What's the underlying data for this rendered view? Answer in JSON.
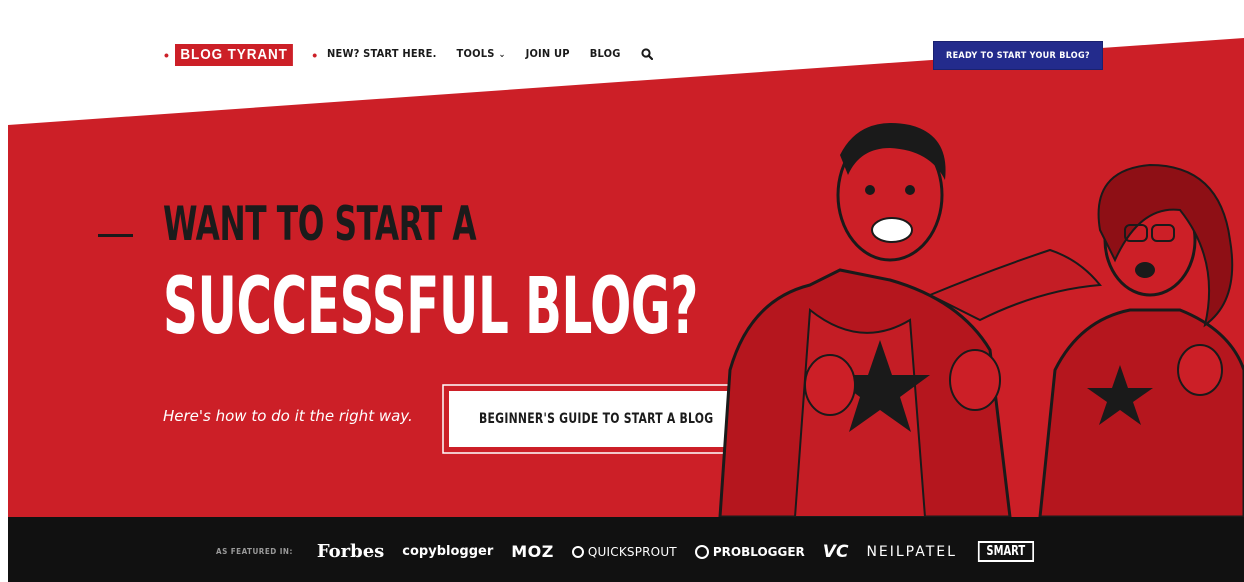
{
  "nav": {
    "logo_text": "BLOG TYRANT",
    "links": [
      {
        "label": "NEW? START HERE."
      },
      {
        "label": "TOOLS",
        "caret": "⌄"
      },
      {
        "label": "JOIN UP"
      },
      {
        "label": "BLOG"
      }
    ],
    "search_icon": "search-icon",
    "cta_label": "READY TO START YOUR BLOG?"
  },
  "hero": {
    "headline_line1": "WANT TO START A",
    "headline_line2": "SUCCESSFUL BLOG?",
    "subtext": "Here's how to do it the right way.",
    "cta_label": "BEGINNER'S GUIDE TO START A BLOG",
    "cta_icon": "double-chevron-right-icon",
    "cta_icon_glyph": "»"
  },
  "featured": {
    "label": "AS FEATURED IN:",
    "brands": [
      "Forbes",
      "copyblogger",
      "MOZ",
      "QUICKSPROUT",
      "PROBLOGGER",
      "VC",
      "NEILPATEL",
      "SMART"
    ]
  },
  "colors": {
    "hero_red": "#cc1f27",
    "nav_cta_blue": "#232b8c",
    "footer_black": "#111111",
    "text_dark": "#1b1b1b"
  }
}
